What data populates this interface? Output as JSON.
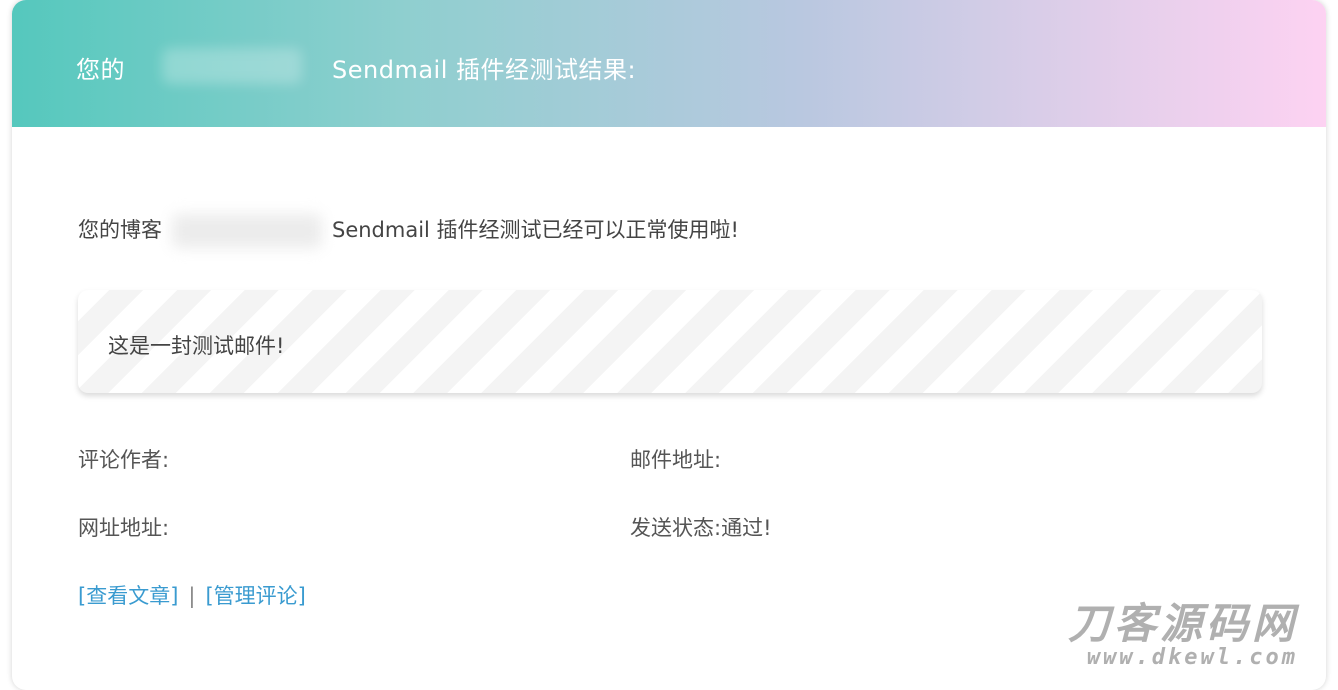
{
  "header": {
    "prefix": "您的",
    "title": "Sendmail 插件经测试结果:"
  },
  "intro": {
    "prefix": "您的博客",
    "suffix": "Sendmail 插件经测试已经可以正常使用啦!"
  },
  "message": {
    "text": "这是一封测试邮件!"
  },
  "info": {
    "author_label": "评论作者:",
    "email_label": "邮件地址:",
    "url_label": "网址地址:",
    "status_label": "发送状态:",
    "status_value": "通过!"
  },
  "links": {
    "view_post": "[查看文章]",
    "separator": "|",
    "manage_comments": "[管理评论]"
  },
  "watermark": {
    "text": "刀客源码网",
    "url": "www.dkewl.com"
  }
}
